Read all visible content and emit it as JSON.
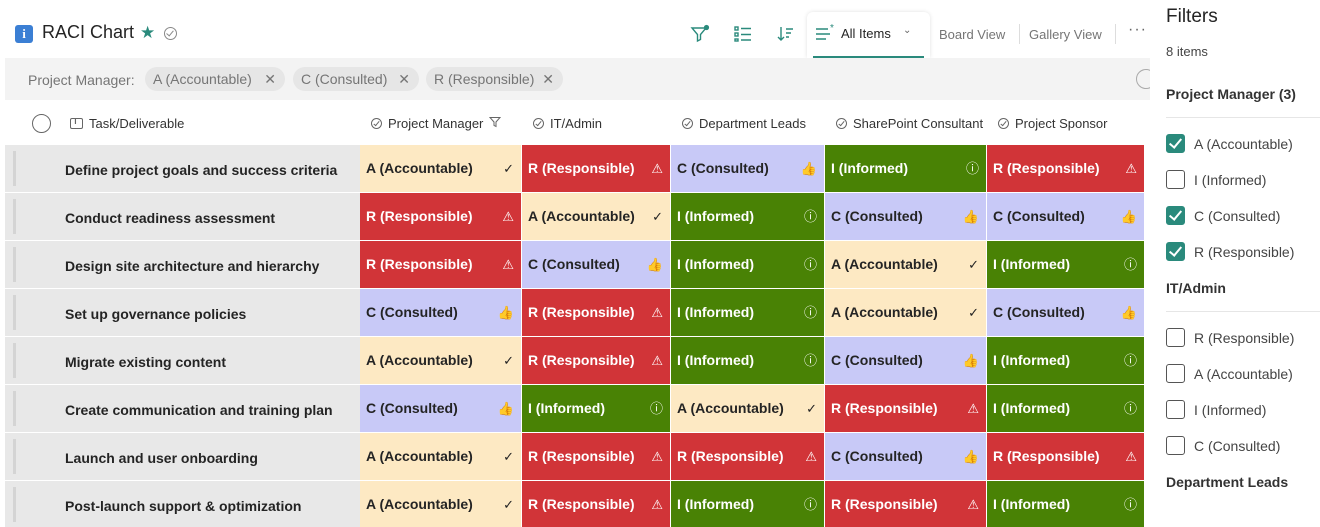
{
  "header": {
    "title": "RACI Chart",
    "list_icon": "i",
    "active_view": "All Items",
    "views": [
      "Board View",
      "Gallery View"
    ],
    "more": "···"
  },
  "filter_bar": {
    "label": "Project Manager:",
    "chips": [
      "A (Accountable)",
      "C (Consulted)",
      "R (Responsible)"
    ]
  },
  "columns": [
    "Task/Deliverable",
    "Project Manager",
    "IT/Admin",
    "Department Leads",
    "SharePoint Consultant",
    "Project Sponsor"
  ],
  "role_icons": {
    "A": "✓",
    "R": "⚠",
    "C": "👍",
    "I": "ⓘ"
  },
  "role_labels": {
    "A": "A (Accountable)",
    "R": "R (Responsible)",
    "C": "C (Consulted)",
    "I": "I (Informed)"
  },
  "rows": [
    {
      "task": "Define project goals and success criteria",
      "roles": [
        "A",
        "R",
        "C",
        "I",
        "R"
      ]
    },
    {
      "task": "Conduct readiness assessment",
      "roles": [
        "R",
        "A",
        "I",
        "C",
        "C"
      ]
    },
    {
      "task": "Design site architecture and hierarchy",
      "roles": [
        "R",
        "C",
        "I",
        "A",
        "I"
      ]
    },
    {
      "task": "Set up governance policies",
      "roles": [
        "C",
        "R",
        "I",
        "A",
        "C"
      ]
    },
    {
      "task": "Migrate existing content",
      "roles": [
        "A",
        "R",
        "I",
        "C",
        "I"
      ]
    },
    {
      "task": "Create communication and training plan",
      "roles": [
        "C",
        "I",
        "A",
        "R",
        "I"
      ]
    },
    {
      "task": "Launch and user onboarding",
      "roles": [
        "A",
        "R",
        "R",
        "C",
        "R"
      ]
    },
    {
      "task": "Post-launch support & optimization",
      "roles": [
        "A",
        "R",
        "I",
        "R",
        "I"
      ]
    }
  ],
  "filters_pane": {
    "title": "Filters",
    "count": "8 items",
    "sections": [
      {
        "title": "Project Manager (3)",
        "options": [
          {
            "label": "A (Accountable)",
            "checked": true
          },
          {
            "label": "I (Informed)",
            "checked": false
          },
          {
            "label": "C (Consulted)",
            "checked": true
          },
          {
            "label": "R (Responsible)",
            "checked": true
          }
        ]
      },
      {
        "title": "IT/Admin",
        "options": [
          {
            "label": "R (Responsible)",
            "checked": false
          },
          {
            "label": "A (Accountable)",
            "checked": false
          },
          {
            "label": "I (Informed)",
            "checked": false
          },
          {
            "label": "C (Consulted)",
            "checked": false
          }
        ]
      },
      {
        "title": "Department Leads",
        "options": []
      }
    ]
  },
  "colors": {
    "A": "#fde9c3",
    "R": "#d13438",
    "C": "#c8c9f7",
    "I": "#498205",
    "accent": "#2a8a7c"
  }
}
